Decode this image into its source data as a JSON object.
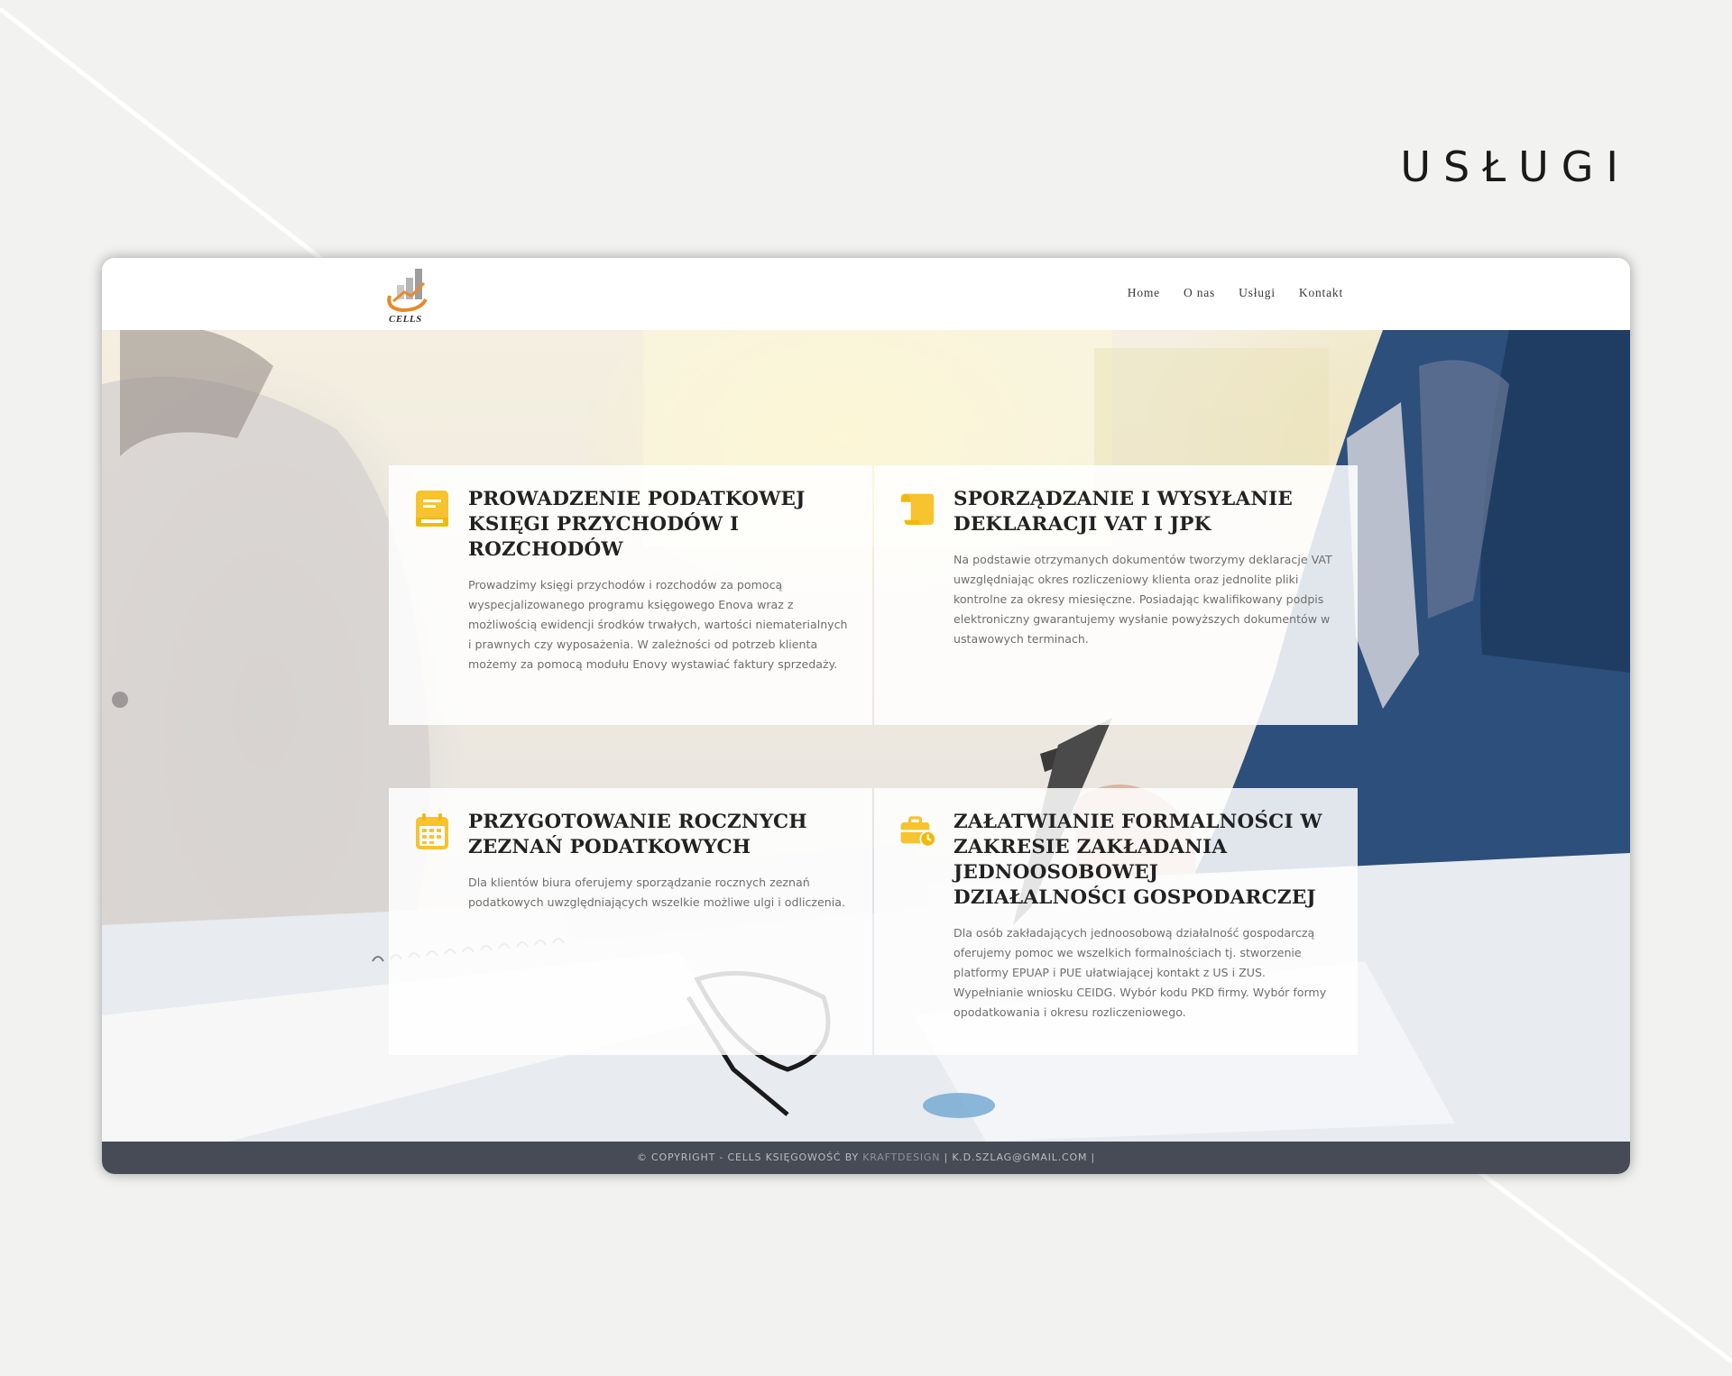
{
  "page_heading": "USŁUGI",
  "site": {
    "logo_text": "CELLS",
    "nav": [
      "Home",
      "O nas",
      "Usługi",
      "Kontakt"
    ]
  },
  "services": [
    {
      "icon": "book-icon",
      "title": "PROWADZENIE PODATKOWEJ KSIĘGI PRZYCHODÓW I ROZCHODÓW",
      "text": "Prowadzimy księgi przychodów i rozchodów za pomocą wyspecjalizowanego programu księgowego Enova wraz z możliwością ewidencji środków trwałych, wartości niematerialnych i prawnych czy wyposażenia. W zależności od potrzeb klienta możemy za pomocą modułu Enovy wystawiać faktury sprzedaży."
    },
    {
      "icon": "scroll-icon",
      "title": "SPORZĄDZANIE I WYSYŁANIE DEKLARACJI VAT I JPK",
      "text": "Na podstawie otrzymanych dokumentów tworzymy deklaracje VAT uwzględniając okres rozliczeniowy klienta oraz jednolite pliki kontrolne za okresy miesięczne. Posiadając kwalifikowany podpis elektroniczny gwarantujemy wysłanie powyższych dokumentów w ustawowych terminach."
    },
    {
      "icon": "calendar-icon",
      "title": "PRZYGOTOWANIE ROCZNYCH ZEZNAŃ PODATKOWYCH",
      "text": "Dla klientów biura oferujemy sporządzanie rocznych zeznań podatkowych uwzględniających wszelkie możliwe ulgi i odliczenia."
    },
    {
      "icon": "briefcase-clock-icon",
      "title": "ZAŁATWIANIE FORMALNOŚCI W ZAKRESIE ZAKŁADANIA JEDNOOSOBOWEJ DZIAŁALNOŚCI GOSPODARCZEJ",
      "text": "Dla osób zakładających jednoosobową działalność gospodarczą oferujemy pomoc we wszelkich formalnościach tj. stworzenie platformy EPUAP i PUE ułatwiającej kontakt z US i ZUS. Wypełnianie wniosku CEIDG. Wybór kodu PKD firmy. Wybór formy opodatkowania i okresu rozliczeniowego."
    }
  ],
  "footer": {
    "prefix": "© COPYRIGHT - CELLS KSIĘGOWOŚĆ BY ",
    "link": "KRAFTDESIGN",
    "suffix": " | K.D.SZLAG@GMAIL.COM |"
  },
  "colors": {
    "accent": "#f7c32e",
    "footer_bg": "#464b55",
    "logo_orange": "#e8892a"
  }
}
